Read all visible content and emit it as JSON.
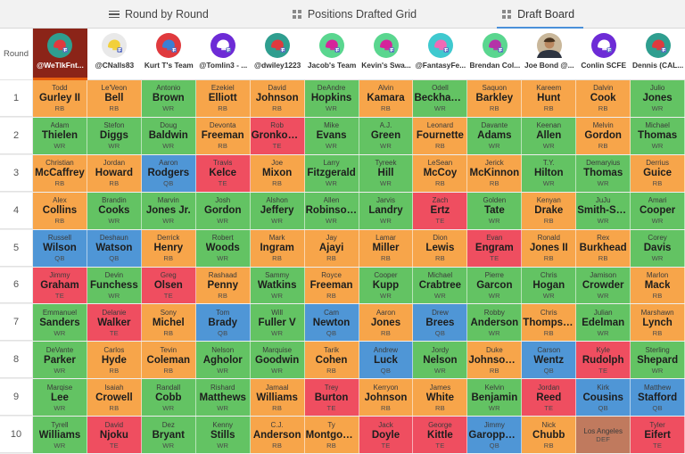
{
  "tabs": [
    {
      "label": "Round by Round",
      "icon": "hamburger-icon",
      "active": false
    },
    {
      "label": "Positions Drafted Grid",
      "icon": "grid-icon",
      "active": false
    },
    {
      "label": "Draft Board",
      "icon": "grid-icon",
      "active": true
    }
  ],
  "round_header_label": "Round",
  "position_colors": {
    "RB": "#f7a54a",
    "WR": "#63c363",
    "QB": "#4f96d6",
    "TE": "#ef4e60",
    "DEF": "#c07a5e"
  },
  "my_team_highlight_color": "#8b2418",
  "teams": [
    {
      "name": "@WeTlkFnt...",
      "avatar": "helmet-icon",
      "avatar_bg": "#2f9e8f",
      "helmet_color": "#e03a3e",
      "is_me": true
    },
    {
      "name": "@CNalls83",
      "avatar": "helmet-icon",
      "avatar_bg": "#e9e9e9",
      "helmet_color": "#f2d03a",
      "is_me": false
    },
    {
      "name": "Kurt T's Team",
      "avatar": "helmet-icon",
      "avatar_bg": "#e03a3e",
      "helmet_color": "#3b7fd4",
      "is_me": false
    },
    {
      "name": "@Tomlin3 - ...",
      "avatar": "helmet-icon",
      "avatar_bg": "#6d2bd6",
      "helmet_color": "#ffffff",
      "is_me": false
    },
    {
      "name": "@dwiley1223",
      "avatar": "helmet-icon",
      "avatar_bg": "#2f9e8f",
      "helmet_color": "#e03a3e",
      "is_me": false
    },
    {
      "name": "Jacob's Team",
      "avatar": "helmet-icon",
      "avatar_bg": "#5ad68f",
      "helmet_color": "#d6239b",
      "is_me": false
    },
    {
      "name": "Kevin's Swa...",
      "avatar": "helmet-icon",
      "avatar_bg": "#5ad68f",
      "helmet_color": "#d6239b",
      "is_me": false
    },
    {
      "name": "@FantasyFe...",
      "avatar": "helmet-icon",
      "avatar_bg": "#3fc9cf",
      "helmet_color": "#f06ab5",
      "is_me": false
    },
    {
      "name": "Brendan Col...",
      "avatar": "helmet-icon",
      "avatar_bg": "#5ad68f",
      "helmet_color": "#b433a8",
      "is_me": false
    },
    {
      "name": "Joe Bond @...",
      "avatar": "photo-avatar",
      "avatar_bg": "#8a6a4a",
      "helmet_color": "#3b3b3b",
      "is_me": false
    },
    {
      "name": "Conlin SCFE",
      "avatar": "helmet-icon",
      "avatar_bg": "#6d2bd6",
      "helmet_color": "#ffffff",
      "is_me": false
    },
    {
      "name": "Dennis (CAL...",
      "avatar": "helmet-icon",
      "avatar_bg": "#2f9e8f",
      "helmet_color": "#e03a3e",
      "is_me": false
    }
  ],
  "rounds": [
    {
      "round": "1",
      "picks": [
        {
          "first": "Todd",
          "last": "Gurley II",
          "pos": "RB"
        },
        {
          "first": "Le'Veon",
          "last": "Bell",
          "pos": "RB"
        },
        {
          "first": "Antonio",
          "last": "Brown",
          "pos": "WR"
        },
        {
          "first": "Ezekiel",
          "last": "Elliott",
          "pos": "RB"
        },
        {
          "first": "David",
          "last": "Johnson",
          "pos": "RB"
        },
        {
          "first": "DeAndre",
          "last": "Hopkins",
          "pos": "WR"
        },
        {
          "first": "Alvin",
          "last": "Kamara",
          "pos": "RB"
        },
        {
          "first": "Odell",
          "last": "Beckham ...",
          "pos": "WR"
        },
        {
          "first": "Saquon",
          "last": "Barkley",
          "pos": "RB"
        },
        {
          "first": "Kareem",
          "last": "Hunt",
          "pos": "RB"
        },
        {
          "first": "Dalvin",
          "last": "Cook",
          "pos": "RB"
        },
        {
          "first": "Julio",
          "last": "Jones",
          "pos": "WR"
        }
      ]
    },
    {
      "round": "2",
      "picks": [
        {
          "first": "Adam",
          "last": "Thielen",
          "pos": "WR"
        },
        {
          "first": "Stefon",
          "last": "Diggs",
          "pos": "WR"
        },
        {
          "first": "Doug",
          "last": "Baldwin",
          "pos": "WR"
        },
        {
          "first": "Devonta",
          "last": "Freeman",
          "pos": "RB"
        },
        {
          "first": "Rob",
          "last": "Gronkowski",
          "pos": "TE"
        },
        {
          "first": "Mike",
          "last": "Evans",
          "pos": "WR"
        },
        {
          "first": "A.J.",
          "last": "Green",
          "pos": "WR"
        },
        {
          "first": "Leonard",
          "last": "Fournette",
          "pos": "RB"
        },
        {
          "first": "Davante",
          "last": "Adams",
          "pos": "WR"
        },
        {
          "first": "Keenan",
          "last": "Allen",
          "pos": "WR"
        },
        {
          "first": "Melvin",
          "last": "Gordon",
          "pos": "RB"
        },
        {
          "first": "Michael",
          "last": "Thomas",
          "pos": "WR"
        }
      ]
    },
    {
      "round": "3",
      "picks": [
        {
          "first": "Christian",
          "last": "McCaffrey",
          "pos": "RB"
        },
        {
          "first": "Jordan",
          "last": "Howard",
          "pos": "RB"
        },
        {
          "first": "Aaron",
          "last": "Rodgers",
          "pos": "QB"
        },
        {
          "first": "Travis",
          "last": "Kelce",
          "pos": "TE"
        },
        {
          "first": "Joe",
          "last": "Mixon",
          "pos": "RB"
        },
        {
          "first": "Larry",
          "last": "Fitzgerald",
          "pos": "WR"
        },
        {
          "first": "Tyreek",
          "last": "Hill",
          "pos": "WR"
        },
        {
          "first": "LeSean",
          "last": "McCoy",
          "pos": "RB"
        },
        {
          "first": "Jerick",
          "last": "McKinnon",
          "pos": "RB"
        },
        {
          "first": "T.Y.",
          "last": "Hilton",
          "pos": "WR"
        },
        {
          "first": "Demaryius",
          "last": "Thomas",
          "pos": "WR"
        },
        {
          "first": "Derrius",
          "last": "Guice",
          "pos": "RB"
        }
      ]
    },
    {
      "round": "4",
      "picks": [
        {
          "first": "Alex",
          "last": "Collins",
          "pos": "RB"
        },
        {
          "first": "Brandin",
          "last": "Cooks",
          "pos": "WR"
        },
        {
          "first": "Marvin",
          "last": "Jones Jr.",
          "pos": "WR"
        },
        {
          "first": "Josh",
          "last": "Gordon",
          "pos": "WR"
        },
        {
          "first": "Alshon",
          "last": "Jeffery",
          "pos": "WR"
        },
        {
          "first": "Allen",
          "last": "Robinson II",
          "pos": "WR"
        },
        {
          "first": "Jarvis",
          "last": "Landry",
          "pos": "WR"
        },
        {
          "first": "Zach",
          "last": "Ertz",
          "pos": "TE"
        },
        {
          "first": "Golden",
          "last": "Tate",
          "pos": "WR"
        },
        {
          "first": "Kenyan",
          "last": "Drake",
          "pos": "RB"
        },
        {
          "first": "JuJu",
          "last": "Smith-Sc...",
          "pos": "WR"
        },
        {
          "first": "Amari",
          "last": "Cooper",
          "pos": "WR"
        }
      ]
    },
    {
      "round": "5",
      "picks": [
        {
          "first": "Russell",
          "last": "Wilson",
          "pos": "QB"
        },
        {
          "first": "Deshaun",
          "last": "Watson",
          "pos": "QB"
        },
        {
          "first": "Derrick",
          "last": "Henry",
          "pos": "RB"
        },
        {
          "first": "Robert",
          "last": "Woods",
          "pos": "WR"
        },
        {
          "first": "Mark",
          "last": "Ingram",
          "pos": "RB"
        },
        {
          "first": "Jay",
          "last": "Ajayi",
          "pos": "RB"
        },
        {
          "first": "Lamar",
          "last": "Miller",
          "pos": "RB"
        },
        {
          "first": "Dion",
          "last": "Lewis",
          "pos": "RB"
        },
        {
          "first": "Evan",
          "last": "Engram",
          "pos": "TE"
        },
        {
          "first": "Ronald",
          "last": "Jones II",
          "pos": "RB"
        },
        {
          "first": "Rex",
          "last": "Burkhead",
          "pos": "RB"
        },
        {
          "first": "Corey",
          "last": "Davis",
          "pos": "WR"
        }
      ]
    },
    {
      "round": "6",
      "picks": [
        {
          "first": "Jimmy",
          "last": "Graham",
          "pos": "TE"
        },
        {
          "first": "Devin",
          "last": "Funchess",
          "pos": "WR"
        },
        {
          "first": "Greg",
          "last": "Olsen",
          "pos": "TE"
        },
        {
          "first": "Rashaad",
          "last": "Penny",
          "pos": "RB"
        },
        {
          "first": "Sammy",
          "last": "Watkins",
          "pos": "WR"
        },
        {
          "first": "Royce",
          "last": "Freeman",
          "pos": "RB"
        },
        {
          "first": "Cooper",
          "last": "Kupp",
          "pos": "WR"
        },
        {
          "first": "Michael",
          "last": "Crabtree",
          "pos": "WR"
        },
        {
          "first": "Pierre",
          "last": "Garcon",
          "pos": "WR"
        },
        {
          "first": "Chris",
          "last": "Hogan",
          "pos": "WR"
        },
        {
          "first": "Jamison",
          "last": "Crowder",
          "pos": "WR"
        },
        {
          "first": "Marlon",
          "last": "Mack",
          "pos": "RB"
        }
      ]
    },
    {
      "round": "7",
      "picks": [
        {
          "first": "Emmanuel",
          "last": "Sanders",
          "pos": "WR"
        },
        {
          "first": "Delanie",
          "last": "Walker",
          "pos": "TE"
        },
        {
          "first": "Sony",
          "last": "Michel",
          "pos": "RB"
        },
        {
          "first": "Tom",
          "last": "Brady",
          "pos": "QB"
        },
        {
          "first": "Will",
          "last": "Fuller V",
          "pos": "WR"
        },
        {
          "first": "Cam",
          "last": "Newton",
          "pos": "QB"
        },
        {
          "first": "Aaron",
          "last": "Jones",
          "pos": "RB"
        },
        {
          "first": "Drew",
          "last": "Brees",
          "pos": "QB"
        },
        {
          "first": "Robby",
          "last": "Anderson",
          "pos": "WR"
        },
        {
          "first": "Chris",
          "last": "Thompson",
          "pos": "RB"
        },
        {
          "first": "Julian",
          "last": "Edelman",
          "pos": "WR"
        },
        {
          "first": "Marshawn",
          "last": "Lynch",
          "pos": "RB"
        }
      ]
    },
    {
      "round": "8",
      "picks": [
        {
          "first": "DeVante",
          "last": "Parker",
          "pos": "WR"
        },
        {
          "first": "Carlos",
          "last": "Hyde",
          "pos": "RB"
        },
        {
          "first": "Tevin",
          "last": "Coleman",
          "pos": "RB"
        },
        {
          "first": "Nelson",
          "last": "Agholor",
          "pos": "WR"
        },
        {
          "first": "Marquise",
          "last": "Goodwin",
          "pos": "WR"
        },
        {
          "first": "Tarik",
          "last": "Cohen",
          "pos": "RB"
        },
        {
          "first": "Andrew",
          "last": "Luck",
          "pos": "QB"
        },
        {
          "first": "Jordy",
          "last": "Nelson",
          "pos": "WR"
        },
        {
          "first": "Duke",
          "last": "Johnson Jr.",
          "pos": "RB"
        },
        {
          "first": "Carson",
          "last": "Wentz",
          "pos": "QB"
        },
        {
          "first": "Kyle",
          "last": "Rudolph",
          "pos": "TE"
        },
        {
          "first": "Sterling",
          "last": "Shepard",
          "pos": "WR"
        }
      ]
    },
    {
      "round": "9",
      "picks": [
        {
          "first": "Marqise",
          "last": "Lee",
          "pos": "WR"
        },
        {
          "first": "Isaiah",
          "last": "Crowell",
          "pos": "RB"
        },
        {
          "first": "Randall",
          "last": "Cobb",
          "pos": "WR"
        },
        {
          "first": "Rishard",
          "last": "Matthews",
          "pos": "WR"
        },
        {
          "first": "Jamaal",
          "last": "Williams",
          "pos": "RB"
        },
        {
          "first": "Trey",
          "last": "Burton",
          "pos": "TE"
        },
        {
          "first": "Kerryon",
          "last": "Johnson",
          "pos": "RB"
        },
        {
          "first": "James",
          "last": "White",
          "pos": "RB"
        },
        {
          "first": "Kelvin",
          "last": "Benjamin",
          "pos": "WR"
        },
        {
          "first": "Jordan",
          "last": "Reed",
          "pos": "TE"
        },
        {
          "first": "Kirk",
          "last": "Cousins",
          "pos": "QB"
        },
        {
          "first": "Matthew",
          "last": "Stafford",
          "pos": "QB"
        }
      ]
    },
    {
      "round": "10",
      "picks": [
        {
          "first": "Tyrell",
          "last": "Williams",
          "pos": "WR"
        },
        {
          "first": "David",
          "last": "Njoku",
          "pos": "TE"
        },
        {
          "first": "Dez",
          "last": "Bryant",
          "pos": "WR"
        },
        {
          "first": "Kenny",
          "last": "Stills",
          "pos": "WR"
        },
        {
          "first": "C.J.",
          "last": "Anderson",
          "pos": "RB"
        },
        {
          "first": "Ty",
          "last": "Montgom...",
          "pos": "RB"
        },
        {
          "first": "Jack",
          "last": "Doyle",
          "pos": "TE"
        },
        {
          "first": "George",
          "last": "Kittle",
          "pos": "TE"
        },
        {
          "first": "Jimmy",
          "last": "Garoppolo",
          "pos": "QB"
        },
        {
          "first": "Nick",
          "last": "Chubb",
          "pos": "RB"
        },
        {
          "first": "Los Angeles",
          "last": "",
          "pos": "DEF"
        },
        {
          "first": "Tyler",
          "last": "Eifert",
          "pos": "TE"
        }
      ]
    }
  ]
}
